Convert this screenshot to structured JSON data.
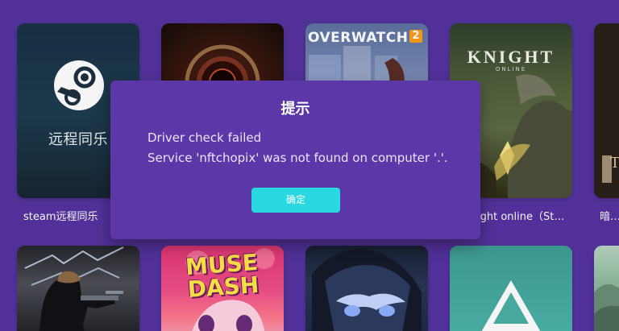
{
  "colors": {
    "background": "#5534a0",
    "modal_background": "#5b37a8",
    "modal_button": "#2ad8e2",
    "text": "#ffffff"
  },
  "library": {
    "top_row": [
      {
        "title": "steam远程同乐",
        "cover_text": "远程同乐",
        "icon": "steam-logo-icon"
      },
      {
        "title": "",
        "icon": "portal-artwork-icon"
      },
      {
        "title": "",
        "logo_text": "OVERWATCH",
        "logo_number": "2",
        "icon": "overwatch-logo-icon"
      },
      {
        "title": "ight online（Ste…",
        "logo_text": "KNIGHT",
        "logo_subtext": "ONLINE",
        "icon": "knight-online-logo-icon"
      },
      {
        "title": "暗黑",
        "cover_text": "T",
        "icon": "partial-cover-icon"
      }
    ],
    "bottom_row": [
      {
        "icon": "soldier-artwork-icon"
      },
      {
        "logo_text": "MUSE DASH",
        "icon": "muse-dash-logo-icon"
      },
      {
        "icon": "anime-character-icon"
      },
      {
        "icon": "triangle-logo-icon"
      },
      {
        "icon": "landscape-artwork-icon"
      }
    ]
  },
  "dialog": {
    "title": "提示",
    "line1": "Driver check failed",
    "line2": "Service 'nftchopix' was not found on computer '.'.",
    "confirm_label": "确定"
  }
}
